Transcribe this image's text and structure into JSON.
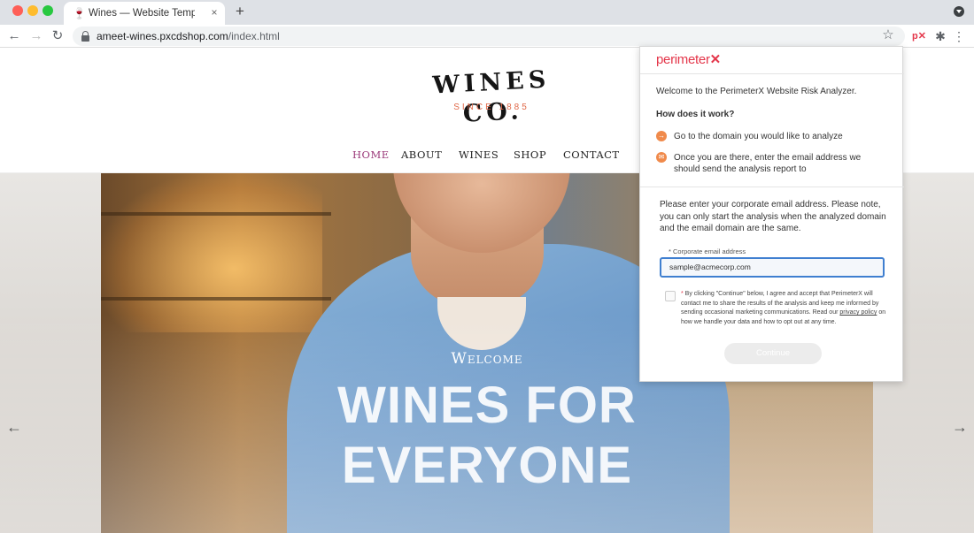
{
  "browser": {
    "tab_title": "Wines — Website Template by",
    "tab_close": "×",
    "new_tab": "+",
    "url_host": "ameet-wines.pxcdshop.com",
    "url_path": "/index.html",
    "ext_px_label": "p✕"
  },
  "icons": {
    "tab_favicon": "wine-glass-icon",
    "back": "arrow-left-icon",
    "forward": "arrow-right-icon",
    "reload": "reload-icon",
    "lock": "lock-icon",
    "star": "star-icon",
    "puzzle": "puzzle-icon",
    "menu": "kebab-menu-icon"
  },
  "site": {
    "logo_name": "WINES CO.",
    "logo_since": "SINCE 1885",
    "menu": [
      {
        "label": "HOME",
        "active": true
      },
      {
        "label": "ABOUT",
        "active": false
      },
      {
        "label": "WINES",
        "active": false
      },
      {
        "label": "SHOP",
        "active": false
      },
      {
        "label": "CONTACT",
        "active": false
      }
    ],
    "hero": {
      "welcome": "Welcome",
      "headline_line1": "WINES FOR",
      "headline_line2": "EVERYONE"
    }
  },
  "popup": {
    "logo_text": "perimeter",
    "logo_mark": "✕",
    "welcome": "Welcome to the PerimeterX Website Risk Analyzer.",
    "how_title": "How does it work?",
    "steps": [
      {
        "text": "Go to the domain you would like to analyze"
      },
      {
        "text": "Once you are there, enter the email address we should send the analysis report to"
      }
    ],
    "note": "Please enter your corporate email address. Please note, you can only start the analysis when the analyzed domain and the email domain are the same.",
    "field_label": "* Corporate email address",
    "email_placeholder": "sample@acmecorp.com",
    "consent_req": "*",
    "consent_text": " By clicking \"Continue\" below, I agree and accept that PerimeterX will contact me to share the results of the analysis and keep me informed by sending occasional marketing communications. Read our ",
    "consent_link": "privacy policy",
    "consent_tail": " on how we handle your data and how to opt out at any time.",
    "continue_label": "Continue"
  },
  "colors": {
    "accent_red": "#e4364a",
    "menu_active": "#9b3a7a",
    "step_icon": "#f08a4b",
    "input_border": "#3f7fd0"
  }
}
